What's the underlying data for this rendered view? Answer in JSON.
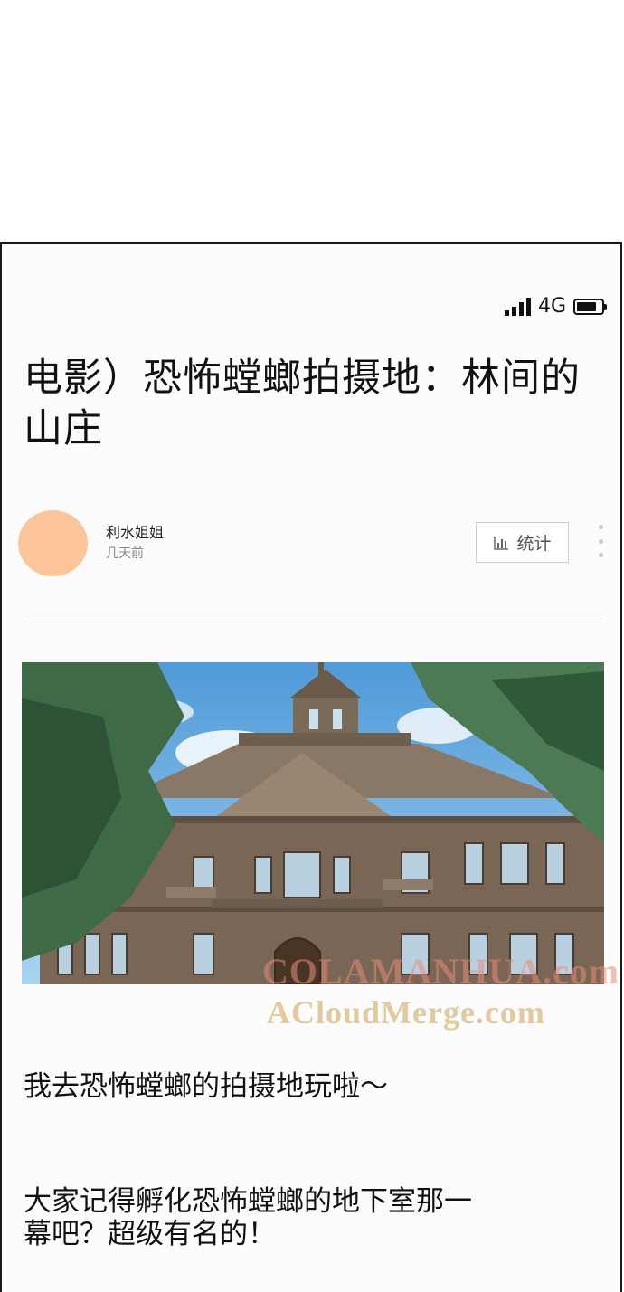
{
  "status_bar": {
    "network": "4G",
    "signal_bars": 4,
    "battery_level": 0.8
  },
  "post": {
    "title": "电影）恐怖螳螂拍摄地：林间的山庄",
    "author": {
      "name": "利水姐姐",
      "time": "几天前",
      "avatar_color": "#fcc59a"
    },
    "stats_button": {
      "label": "统计",
      "icon": "bar-chart-icon"
    },
    "more_menu": {
      "icon": "vertical-dots-icon"
    },
    "hero_image": {
      "alt": "mansion-among-trees"
    },
    "paragraphs": [
      "我去恐怖螳螂的拍摄地玩啦～",
      "大家记得孵化恐怖螳螂的地下室那一幕吧？超级有名的！"
    ]
  },
  "watermark": {
    "line1": "COLAMANHUA.com",
    "line2": "ACloudMerge.com"
  },
  "colors": {
    "text": "#111111",
    "muted": "#888888",
    "frame_border": "#1a1a1a",
    "divider": "#dedede"
  }
}
